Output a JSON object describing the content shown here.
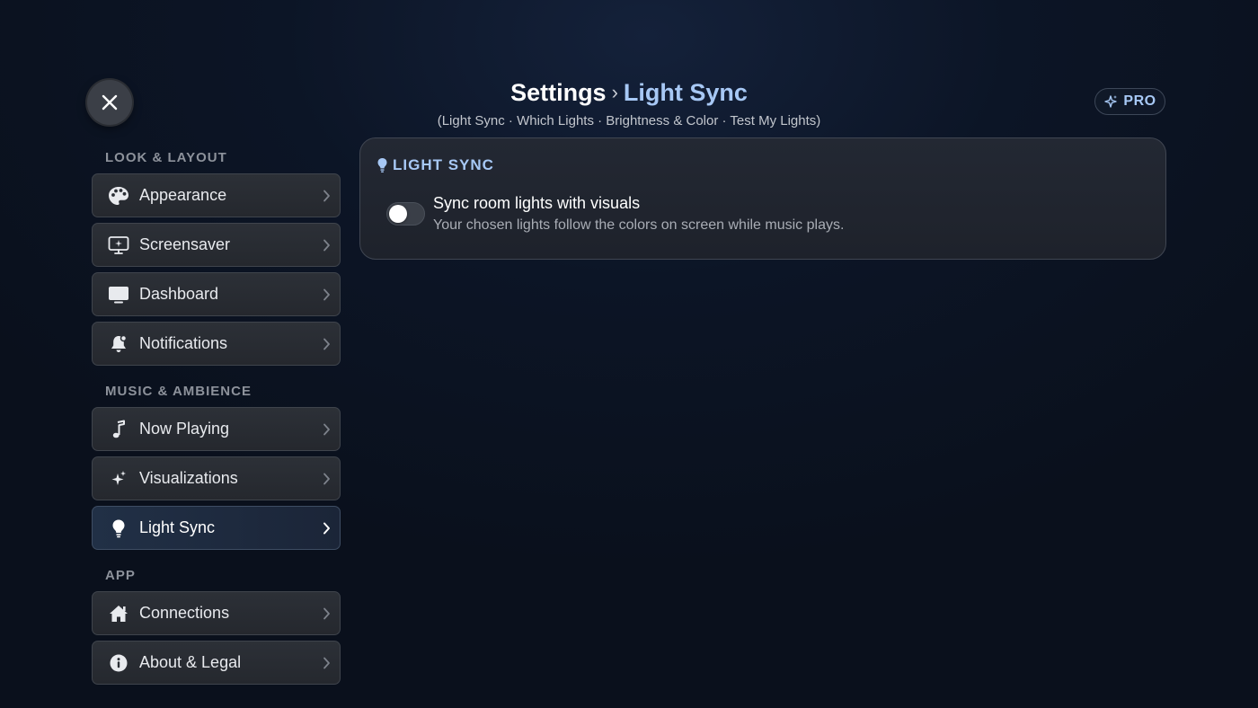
{
  "header": {
    "breadcrumb_root": "Settings",
    "breadcrumb_separator": "›",
    "breadcrumb_current": "Light Sync",
    "subtitle": "(Light Sync · Which Lights · Brightness & Color · Test My Lights)"
  },
  "pro_badge": {
    "label": "PRO",
    "icon": "sparkle-icon"
  },
  "close_button": {
    "icon": "close-icon"
  },
  "sidebar": {
    "sections": [
      {
        "label": "LOOK & LAYOUT"
      },
      {
        "label": "MUSIC & AMBIENCE"
      },
      {
        "label": "APP"
      }
    ],
    "items": [
      {
        "label": "Appearance",
        "icon": "palette-icon"
      },
      {
        "label": "Screensaver",
        "icon": "screensaver-icon"
      },
      {
        "label": "Dashboard",
        "icon": "display-icon"
      },
      {
        "label": "Notifications",
        "icon": "bell-icon"
      },
      {
        "label": "Now Playing",
        "icon": "music-note-icon"
      },
      {
        "label": "Visualizations",
        "icon": "sparkle-icon"
      },
      {
        "label": "Light Sync",
        "icon": "lightbulb-icon",
        "active": true
      },
      {
        "label": "Connections",
        "icon": "home-icon"
      },
      {
        "label": "About & Legal",
        "icon": "info-icon"
      }
    ]
  },
  "panel": {
    "title": "LIGHT SYNC",
    "setting": {
      "title": "Sync room lights with visuals",
      "description": "Your chosen lights follow the colors on screen while music plays.",
      "enabled": false
    }
  },
  "colors": {
    "accent": "#a7c8f5",
    "background": "#0c1526",
    "card": "#2a2e35",
    "active_item": "#1f2c42"
  }
}
